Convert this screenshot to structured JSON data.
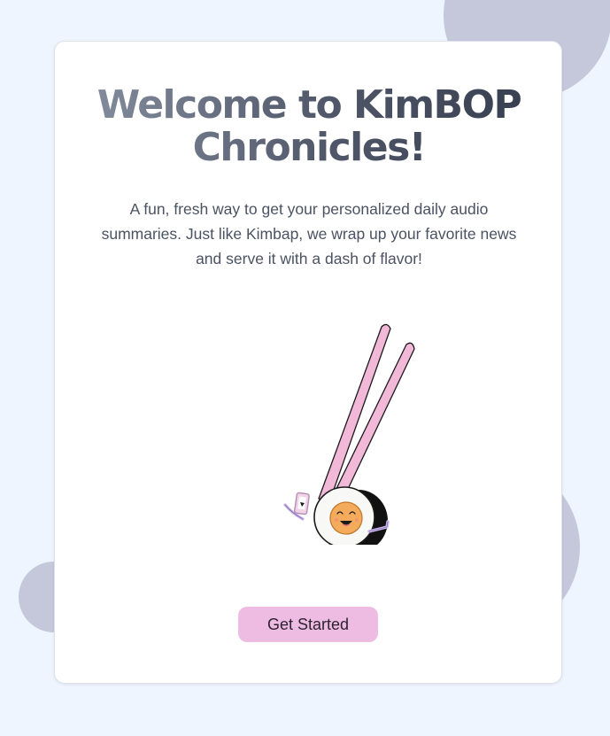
{
  "welcome": {
    "title": "Welcome to KimBOP Chronicles!",
    "description": "A fun, fresh way to get your personalized daily audio summaries. Just like Kimbap, we wrap up your favorite news and serve it with a dash of flavor!",
    "mascot_icon": "kimbap-mascot-with-chopsticks-icon",
    "cta_label": "Get Started"
  },
  "colors": {
    "page_background": "#eef5ff",
    "decor_circles": "#c5c8da",
    "card_background": "#ffffff",
    "title_gradient_start": "#8a93a3",
    "title_gradient_end": "#333b4c",
    "body_text": "#4b5262",
    "button_background": "#eebce3",
    "chopsticks": "#f2b8d8",
    "mascot_limbs": "#c9b3ec",
    "mascot_face": "#f4ac5c"
  }
}
